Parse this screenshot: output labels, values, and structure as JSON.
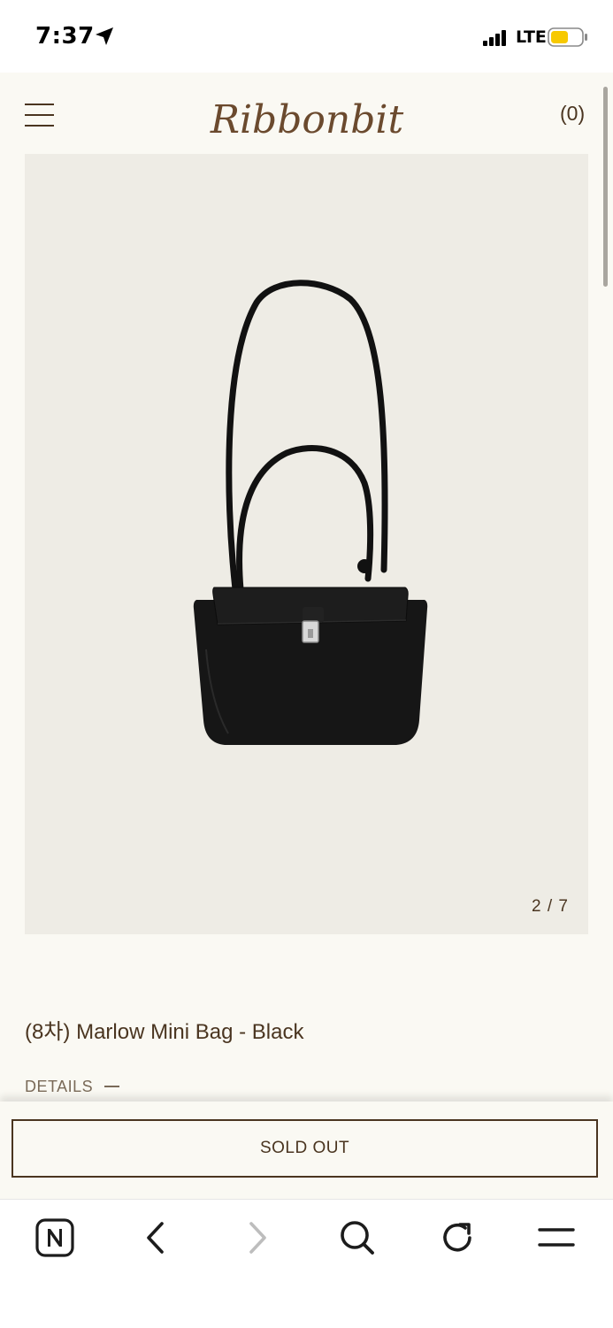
{
  "status_bar": {
    "time": "7:37",
    "network": "LTE",
    "battery_color": "#f7c900"
  },
  "header": {
    "logo_text": "Ribbonbit",
    "cart_count": "(0)"
  },
  "product": {
    "image_counter": "2 / 7",
    "title": "(8차) Marlow Mini Bag - Black",
    "details_label": "DETAILS"
  },
  "purchase": {
    "sold_out_label": "SOLD OUT"
  },
  "browser_toolbar": {
    "icons": [
      "naver-home-icon",
      "back-icon",
      "forward-icon",
      "search-icon",
      "refresh-icon",
      "menu-icon"
    ]
  },
  "colors": {
    "brand_brown": "#4a3520",
    "page_bg": "#faf9f3",
    "image_bg": "#eeece5"
  }
}
